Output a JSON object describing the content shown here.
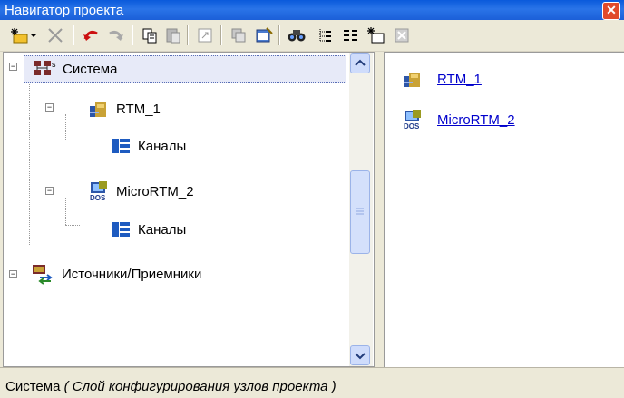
{
  "window": {
    "title": "Навигатор проекта"
  },
  "toolbar": {
    "buttons": [
      {
        "icon": "new-item-icon"
      },
      {
        "icon": "dropdown-arrow-icon"
      },
      {
        "icon": "delete-icon"
      },
      {
        "icon": "undo-icon"
      },
      {
        "icon": "redo-icon"
      },
      {
        "icon": "copy-icon"
      },
      {
        "icon": "paste-icon"
      },
      {
        "icon": "resize-icon"
      },
      {
        "icon": "clone-icon"
      },
      {
        "icon": "properties-icon"
      },
      {
        "icon": "find-icon"
      },
      {
        "icon": "tree-view-icon"
      },
      {
        "icon": "list-view-icon"
      },
      {
        "icon": "new-window-icon"
      },
      {
        "icon": "close-doc-icon"
      }
    ]
  },
  "tree": {
    "items": [
      {
        "label": "Система",
        "icon": "system-network-icon",
        "selected": true
      },
      {
        "label": "RTM_1",
        "icon": "rtm-station-icon"
      },
      {
        "label": "Каналы",
        "icon": "channels-icon"
      },
      {
        "label": "MicroRTM_2",
        "icon": "dos-station-icon"
      },
      {
        "label": "Каналы",
        "icon": "channels-icon"
      },
      {
        "label": "Источники/Приемники",
        "icon": "sources-receivers-icon"
      }
    ]
  },
  "content": {
    "items": [
      {
        "label": "RTM_1",
        "icon": "rtm-station-icon"
      },
      {
        "label": "MicroRTM_2",
        "icon": "dos-station-icon"
      }
    ]
  },
  "status": {
    "main": "Система",
    "detail": "( Слой конфигурирования узлов проекта )"
  },
  "colors": {
    "titlebar": "#0a5adb",
    "link": "#0000cc",
    "close": "#e04a2a"
  }
}
